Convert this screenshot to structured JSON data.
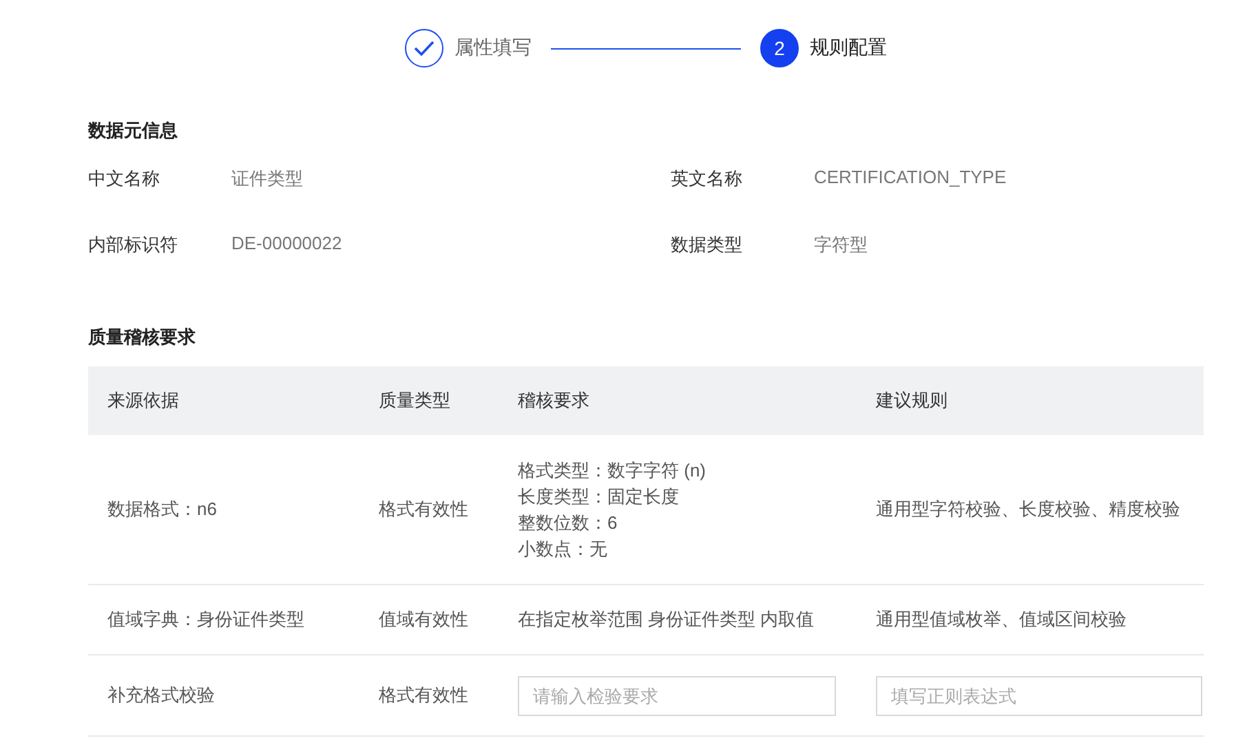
{
  "steps": [
    {
      "label": "属性填写",
      "done": true,
      "current": false
    },
    {
      "number": "2",
      "label": "规则配置",
      "done": false,
      "current": true
    }
  ],
  "metadata": {
    "title": "数据元信息",
    "fields": [
      {
        "label": "中文名称",
        "value": "证件类型"
      },
      {
        "label": "英文名称",
        "value": "CERTIFICATION_TYPE"
      },
      {
        "label": "内部标识符",
        "value": "DE-00000022"
      },
      {
        "label": "数据类型",
        "value": "字符型"
      }
    ]
  },
  "quality": {
    "title": "质量稽核要求",
    "table": {
      "columns": [
        "来源依据",
        "质量类型",
        "稽核要求",
        "建议规则"
      ],
      "rows": [
        {
          "cells": [
            {
              "kind": "text",
              "text": "数据格式：n6"
            },
            {
              "kind": "text",
              "text": "格式有效性"
            },
            {
              "kind": "lines",
              "lines": [
                "格式类型：数字字符 (n)",
                "长度类型：固定长度",
                "整数位数：6",
                "小数点：无"
              ]
            },
            {
              "kind": "text",
              "text": "通用型字符校验、长度校验、精度校验"
            }
          ]
        },
        {
          "cells": [
            {
              "kind": "text",
              "text": "值域字典：身份证件类型"
            },
            {
              "kind": "text",
              "text": "值域有效性"
            },
            {
              "kind": "text",
              "text": "在指定枚举范围 身份证件类型 内取值"
            },
            {
              "kind": "text",
              "text": "通用型值域枚举、值域区间校验"
            }
          ]
        },
        {
          "cells": [
            {
              "kind": "text",
              "text": "补充格式校验"
            },
            {
              "kind": "text",
              "text": "格式有效性"
            },
            {
              "kind": "input",
              "placeholder": "请输入检验要求"
            },
            {
              "kind": "input",
              "placeholder": "填写正则表达式"
            }
          ]
        }
      ]
    }
  }
}
